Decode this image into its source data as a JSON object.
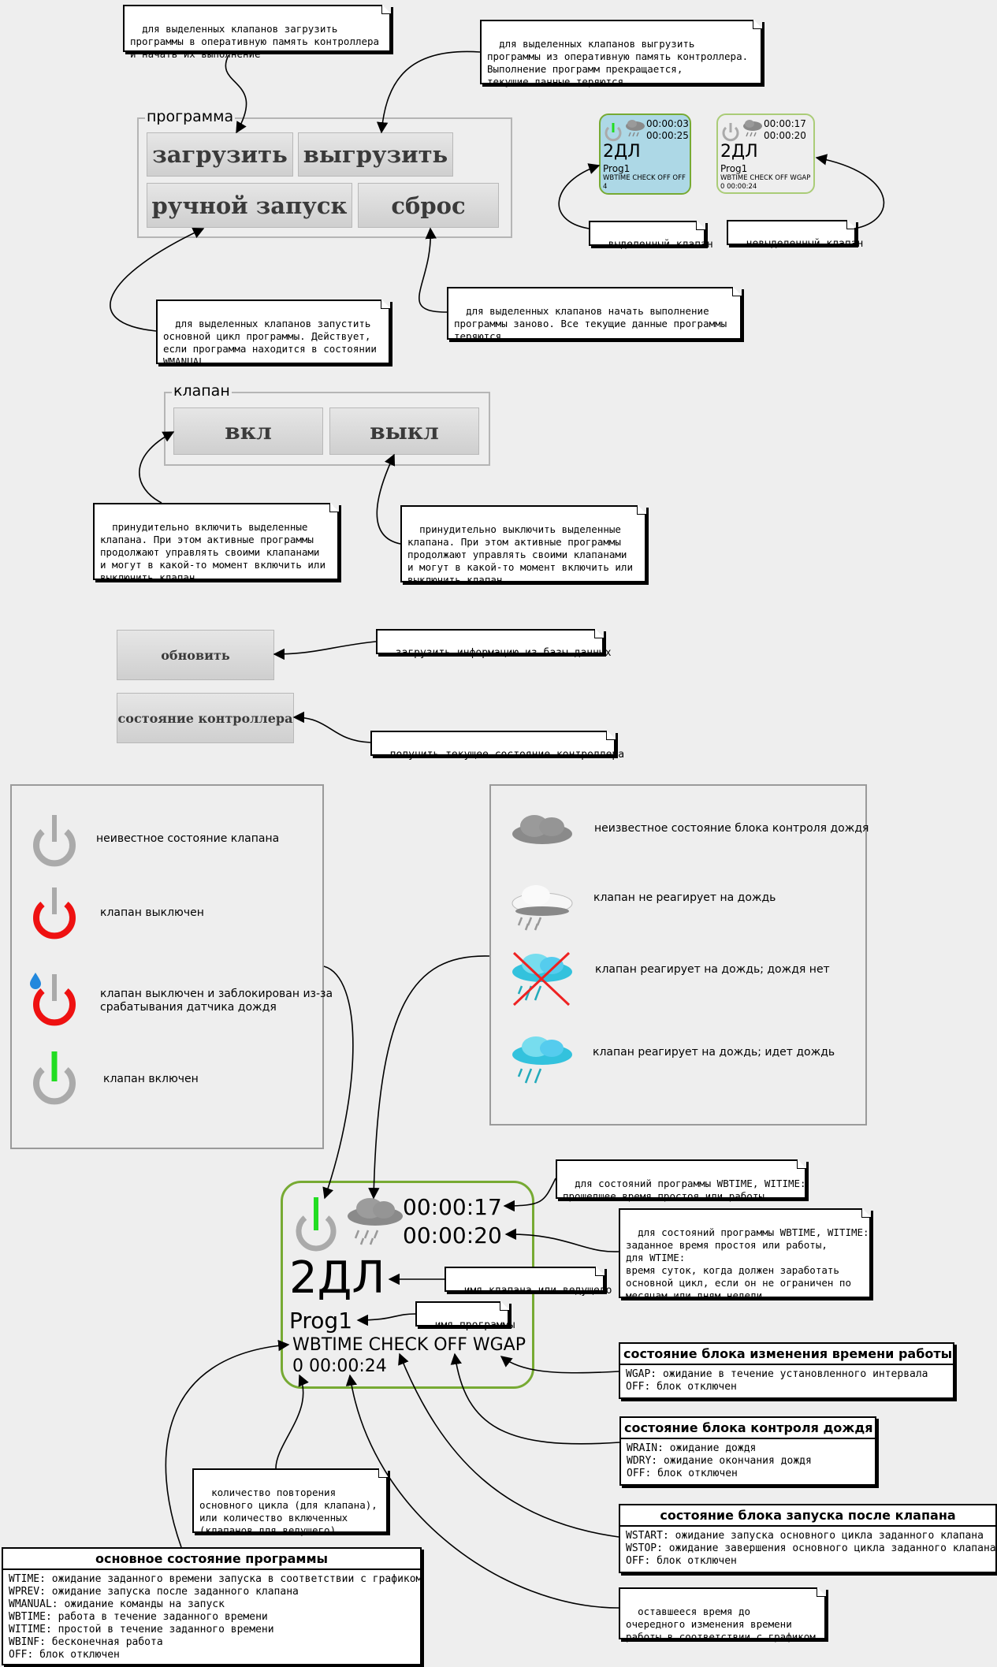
{
  "notes": {
    "load": "для выделенных клапанов загрузить\nпрограммы в оперативную память контроллера\nи начать их выполнение",
    "unload": "для выделенных клапанов выгрузить\nпрограммы из оперативную память контроллера.\nВыполнение программ прекращается,\nтекущие данные теряются.",
    "selected": "выделенный клапан",
    "unselected": "невыделенный клапан",
    "manual": "для выделенных клапанов запустить\nосновной цикл программы. Действует,\nесли программа находится в состоянии\nWMANUAL",
    "reset": "для выделенных клапанов начать выполнение\nпрограммы заново. Все текущие данные программы\nтеряются.",
    "on": "принудительно включить выделенные\nклапана. При этом активные программы\nпродолжают управлять своими клапанами\nи могут в какой-то момент включить или\nвыключить клапан.",
    "off": "принудительно выключить выделенные\nклапана. При этом активные программы\nпродолжают управлять своими клапанами\nи могут в какой-то момент включить или\nвыключить клапан.",
    "refresh": "загрузить информацию из базы данных",
    "ctrl": "получить текущее состояние контроллера",
    "elapsed": "для состояний программы WBTIME, WITIME:\nпрошедшее время простоя или работы",
    "set_time": "для состояний программы WBTIME, WITIME:\nзаданное время простоя или работы,\nдля WTIME:\nвремя суток, когда должен заработать\nосновной цикл, если он не ограничен по\nмесяцам или дням недели.",
    "valve_name": "имя клапана или ведущего",
    "prog_name": "имя программы",
    "repeat": "количество повторения\nосновного цикла (для клапана),\nили количество включенных\n(клапанов для ведущего)",
    "remaining": "оставшееся время до\nочередного изменения времени\nработы в соответствии с графиком"
  },
  "program_group": {
    "legend": "программа",
    "load": "загрузить",
    "unload": "выгрузить",
    "manual": "ручной запуск",
    "reset": "сброс"
  },
  "valve_group": {
    "legend": "клапан",
    "on": "вкл",
    "off": "выкл"
  },
  "buttons": {
    "refresh": "обновить",
    "ctrl_state": "состояние контроллера"
  },
  "valve_selected": {
    "t1": "00:00:03",
    "t2": "00:00:25",
    "name": "2ДЛ",
    "prog": "Prog1",
    "status": "WBTIME CHECK OFF OFF",
    "extra": "4"
  },
  "valve_unselected": {
    "t1": "00:00:17",
    "t2": "00:00:20",
    "name": "2ДЛ",
    "prog": "Prog1",
    "status": "WBTIME CHECK OFF WGAP",
    "extra": "0 00:00:24"
  },
  "valve_big": {
    "t1": "00:00:17",
    "t2": "00:00:20",
    "name": "2ДЛ",
    "prog": "Prog1",
    "status": "WBTIME CHECK OFF WGAP",
    "extra": "0 00:00:24"
  },
  "legend_left": [
    "неивестное состояние клапана",
    "клапан выключен",
    "клапан выключен и заблокирован из-за\nсрабатывания датчика дождя",
    "клапан включен"
  ],
  "legend_right": [
    "неизвестное состояние блока контроля дождя",
    "клапан не реагирует на дождь",
    "клапан реагирует на дождь; дождя нет",
    "клапан реагирует на дождь; идет дождь"
  ],
  "boxes": {
    "gap": {
      "title": "состояние блока изменения времени работы",
      "body": "WGAP: ожидание в течение установленного интервала\nOFF: блок отключен"
    },
    "rain": {
      "title": "состояние блока контроля дождя",
      "body": "WRAIN: ожидание дождя\nWDRY: ожидание окончания дождя\nOFF: блок отключен"
    },
    "start": {
      "title": "состояние блока запуска после клапана",
      "body": "WSTART: ожидание запуска основного цикла заданного клапана\nWSTOP: ожидание завершения основного цикла заданного клапана\nOFF: блок отключен"
    },
    "main": {
      "title": "основное состояние программы",
      "body": "WTIME: ожидание заданного времени запуска в соответствии с графиком\nWPREV: ожидание запуска после заданного клапана\nWMANUAL: ожидание команды на запуск\nWBTIME: работа в течение заданного времени\nWITIME: простой в течение заданного времени\nWBINF: бесконечная работа\nOFF: блок отключен"
    }
  },
  "colors": {
    "selected_bg": "#add8e6",
    "valve_border": "#77aa33",
    "power_on": "#22dd22",
    "power_off": "#ee1111",
    "power_unknown": "#aaaaaa"
  }
}
